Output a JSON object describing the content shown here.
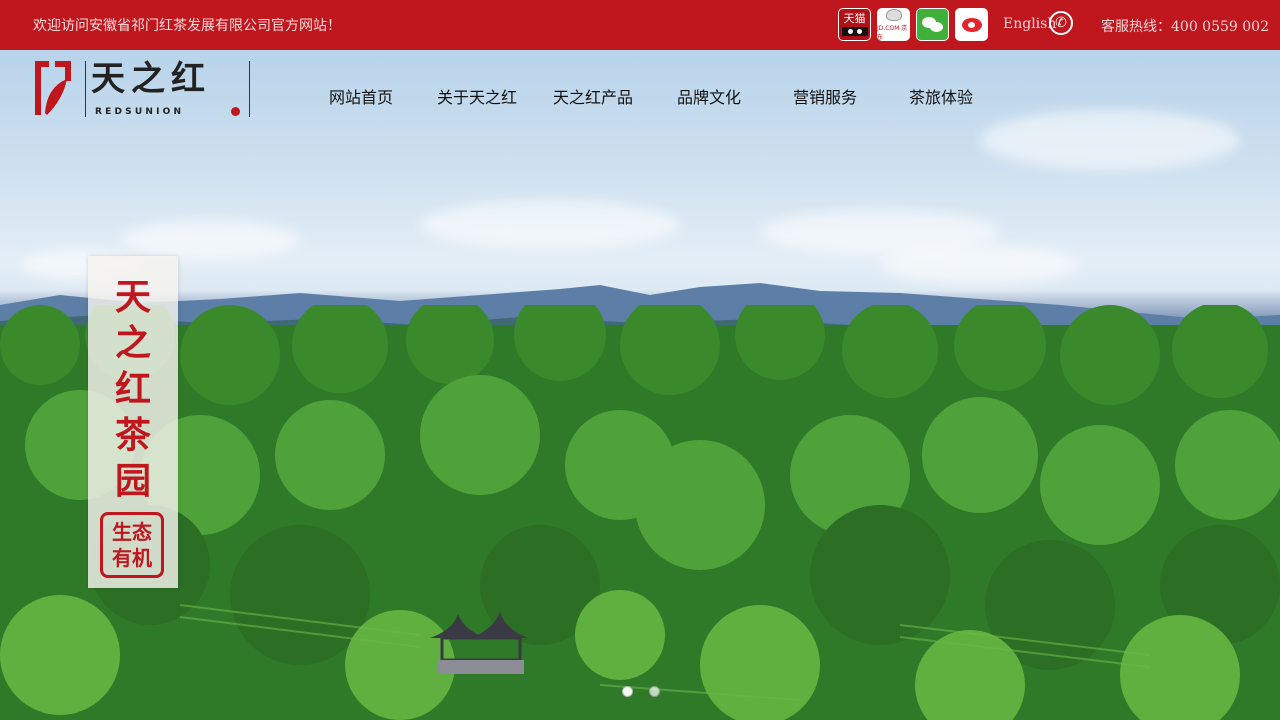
{
  "topbar": {
    "welcome": "欢迎访问安徽省祁门红茶发展有限公司官方网站！",
    "stores": [
      {
        "name": "tmall",
        "label": "天猫",
        "icon": "tmall-cat-icon"
      },
      {
        "name": "jd",
        "label": "JD.COM 京东",
        "icon": "jd-dog-icon"
      },
      {
        "name": "wechat",
        "label": "",
        "icon": "wechat-icon"
      },
      {
        "name": "weibo",
        "label": "",
        "icon": "weibo-icon"
      }
    ],
    "language": "English",
    "phone_icon": "phone-icon",
    "hotline": "客服热线：400 0559 002"
  },
  "logo": {
    "cn": "天之红",
    "en": "REDSUNION"
  },
  "nav": {
    "items": [
      "网站首页",
      "关于天之红",
      "天之红产品",
      "品牌文化",
      "营销服务",
      "茶旅体验"
    ]
  },
  "banner": {
    "title": "天之红茶园",
    "seal": "生态有机"
  },
  "slider": {
    "count": 2,
    "active": 1
  },
  "colors": {
    "brand_red": "#c0161e",
    "forest_green": "#3d8c2a"
  }
}
